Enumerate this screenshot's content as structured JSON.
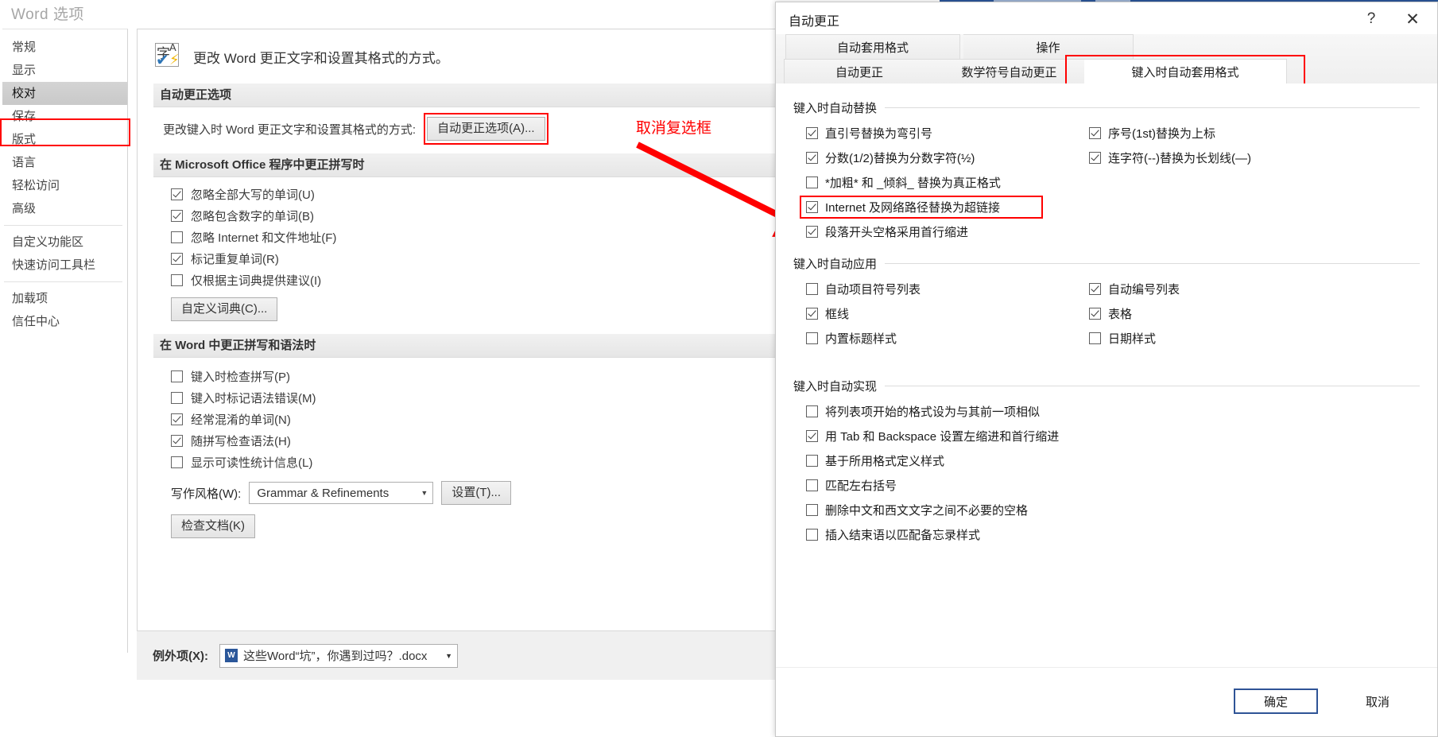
{
  "word_options": {
    "title": "Word 选项",
    "sidebar": [
      {
        "label": "常规",
        "selected": false
      },
      {
        "label": "显示",
        "selected": false
      },
      {
        "label": "校对",
        "selected": true
      },
      {
        "label": "保存",
        "selected": false
      },
      {
        "label": "版式",
        "selected": false
      },
      {
        "label": "语言",
        "selected": false
      },
      {
        "label": "轻松访问",
        "selected": false
      },
      {
        "label": "高级",
        "selected": false
      },
      {
        "label": "自定义功能区",
        "selected": false
      },
      {
        "label": "快速访问工具栏",
        "selected": false
      },
      {
        "label": "加载项",
        "selected": false
      },
      {
        "label": "信任中心",
        "selected": false
      }
    ],
    "header_text": "更改 Word 更正文字和设置其格式的方式。",
    "section_autocorrect": "自动更正选项",
    "autocorrect_row_label": "更改键入时 Word 更正文字和设置其格式的方式:",
    "autocorrect_button": "自动更正选项(A)...",
    "section_office": "在 Microsoft Office 程序中更正拼写时",
    "office_options": [
      {
        "label": "忽略全部大写的单词(U)",
        "checked": true
      },
      {
        "label": "忽略包含数字的单词(B)",
        "checked": true
      },
      {
        "label": "忽略 Internet 和文件地址(F)",
        "checked": false
      },
      {
        "label": "标记重复单词(R)",
        "checked": true
      },
      {
        "label": "仅根据主词典提供建议(I)",
        "checked": false
      }
    ],
    "custom_dict_button": "自定义词典(C)...",
    "section_word": "在 Word 中更正拼写和语法时",
    "word_options_list": [
      {
        "label": "键入时检查拼写(P)",
        "checked": false
      },
      {
        "label": "键入时标记语法错误(M)",
        "checked": false
      },
      {
        "label": "经常混淆的单词(N)",
        "checked": true
      },
      {
        "label": "随拼写检查语法(H)",
        "checked": true
      },
      {
        "label": "显示可读性统计信息(L)",
        "checked": false
      }
    ],
    "writing_style_label": "写作风格(W):",
    "writing_style_value": "Grammar & Refinements",
    "settings_button": "设置(T)...",
    "recheck_button": "检查文档(K)",
    "exceptions_label": "例外项(X):",
    "exceptions_value": "这些Word“坑”，你遇到过吗？.docx"
  },
  "annotation": {
    "text": "取消复选框",
    "color": "#ff0000"
  },
  "autocorrect_dialog": {
    "title": "自动更正",
    "help_icon": "?",
    "close_icon": "✕",
    "tabs_row1": [
      {
        "label": "自动套用格式",
        "active": false
      },
      {
        "label": "操作",
        "active": false
      }
    ],
    "tabs_row2": [
      {
        "label": "自动更正",
        "active": false
      },
      {
        "label": "数学符号自动更正",
        "active": false
      },
      {
        "label": "键入时自动套用格式",
        "active": true
      }
    ],
    "group_replace": {
      "title": "键入时自动替换",
      "left": [
        {
          "label": "直引号替换为弯引号",
          "checked": true
        },
        {
          "label": "分数(1/2)替换为分数字符(½)",
          "checked": true
        },
        {
          "label": "*加粗* 和 _倾斜_ 替换为真正格式",
          "checked": false
        },
        {
          "label": "Internet 及网络路径替换为超链接",
          "checked": true,
          "highlighted": true
        },
        {
          "label": "段落开头空格采用首行缩进",
          "checked": true
        }
      ],
      "right": [
        {
          "label": "序号(1st)替换为上标",
          "checked": true
        },
        {
          "label": "连字符(--)替换为长划线(—)",
          "checked": true
        }
      ]
    },
    "group_apply": {
      "title": "键入时自动应用",
      "left": [
        {
          "label": "自动项目符号列表",
          "checked": false
        },
        {
          "label": "框线",
          "checked": true
        },
        {
          "label": "内置标题样式",
          "checked": false
        }
      ],
      "right": [
        {
          "label": "自动编号列表",
          "checked": true
        },
        {
          "label": "表格",
          "checked": true
        },
        {
          "label": "日期样式",
          "checked": false
        }
      ]
    },
    "group_auto": {
      "title": "键入时自动实现",
      "items": [
        {
          "label": "将列表项开始的格式设为与其前一项相似",
          "checked": false
        },
        {
          "label": "用 Tab 和 Backspace 设置左缩进和首行缩进",
          "checked": true
        },
        {
          "label": "基于所用格式定义样式",
          "checked": false
        },
        {
          "label": "匹配左右括号",
          "checked": false
        },
        {
          "label": "删除中文和西文文字之间不必要的空格",
          "checked": false
        },
        {
          "label": "插入结束语以匹配备忘录样式",
          "checked": false
        }
      ]
    },
    "ok_button": "确定",
    "cancel_button": "取消"
  }
}
